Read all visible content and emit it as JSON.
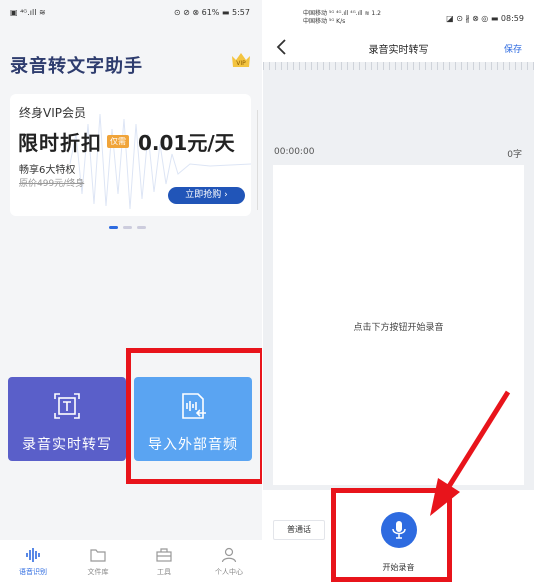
{
  "left_screen": {
    "status_bar": {
      "left": "▣ ⁴ᴳ.ıll ≋",
      "right": "⊙ ⊘ ⊗ 61% ▬ 5:57"
    },
    "app_title": "录音转文字助手",
    "vip_badge": "VIP",
    "banner": {
      "title": "终身VIP会员",
      "headline": "限时折扣",
      "tag": "仅需",
      "price": "0.01元/天",
      "sub": "畅享6大特权",
      "original": "原价499元/终身",
      "cta": "立即抢购 ›"
    },
    "carousel": {
      "count": 3,
      "active": 0
    },
    "cards": [
      {
        "label": "录音实时转写",
        "icon": "text-frame-icon",
        "color": "#5a5fc9"
      },
      {
        "label": "导入外部音频",
        "icon": "audio-import-icon",
        "color": "#5aa4f2"
      }
    ],
    "bottom_nav": [
      {
        "label": "语音识别",
        "icon": "waveform-icon",
        "active": true
      },
      {
        "label": "文件库",
        "icon": "folder-icon",
        "active": false
      },
      {
        "label": "工具",
        "icon": "toolbox-icon",
        "active": false
      },
      {
        "label": "个人中心",
        "icon": "user-icon",
        "active": false
      }
    ]
  },
  "right_screen": {
    "status_bar": {
      "carrier_top": "中国移动 ⁵ᴳ ⁴ᴳ.ıll ⁴ᴳ.ıll ≋ 1.2",
      "carrier_bottom": "中国移动 ⁵ᴳ K/s",
      "right": "◪ ⊙ ∦ ⊗ ◎ ▬ 08:59"
    },
    "header": {
      "title": "录音实时转写",
      "save": "保存"
    },
    "timer": "00:00:00",
    "char_count": "0字",
    "hint": "点击下方按钮开始录音",
    "language": "普通话",
    "record_label": "开始录音"
  },
  "accent_color": "#2e6be0",
  "highlight_color": "#e8141b"
}
